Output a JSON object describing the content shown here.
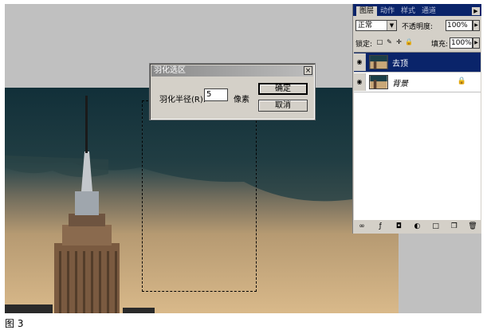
{
  "dialog": {
    "title": "羽化选区",
    "close_glyph": "×",
    "radius_label": "羽化半径(R):",
    "radius_value": "5",
    "unit": "像素",
    "ok_label": "确定",
    "cancel_label": "取消"
  },
  "layers_panel": {
    "tabs": [
      {
        "label": "图层",
        "active": true
      },
      {
        "label": "动作",
        "active": false
      },
      {
        "label": "样式",
        "active": false
      },
      {
        "label": "通道",
        "active": false
      }
    ],
    "menu_glyph": "▶",
    "blend_mode": "正常",
    "blend_arrow": "▼",
    "opacity_label": "不透明度:",
    "opacity_value": "100%",
    "stepper_glyph": "▶",
    "lock_label": "锁定:",
    "lock_icons": [
      "□",
      "✎",
      "✛",
      "🔒"
    ],
    "fill_label": "填充:",
    "fill_value": "100%",
    "layers": [
      {
        "name": "去顶",
        "selected": true,
        "italic": false,
        "locked": false
      },
      {
        "name": "背景",
        "selected": false,
        "italic": true,
        "locked": true
      }
    ],
    "eye_glyph": "◉",
    "lock_glyph": "🔒",
    "bottom_icons": [
      "∞",
      "ƒ",
      "◘",
      "◐",
      "□",
      "❐",
      "🗑"
    ]
  },
  "caption": "图 3",
  "colors": {
    "sky_dark": "#0f2f3a",
    "sky_light": "#c9a878",
    "selection_highlight": "#0a246a",
    "dialog_gray": "#d4d0c8"
  }
}
